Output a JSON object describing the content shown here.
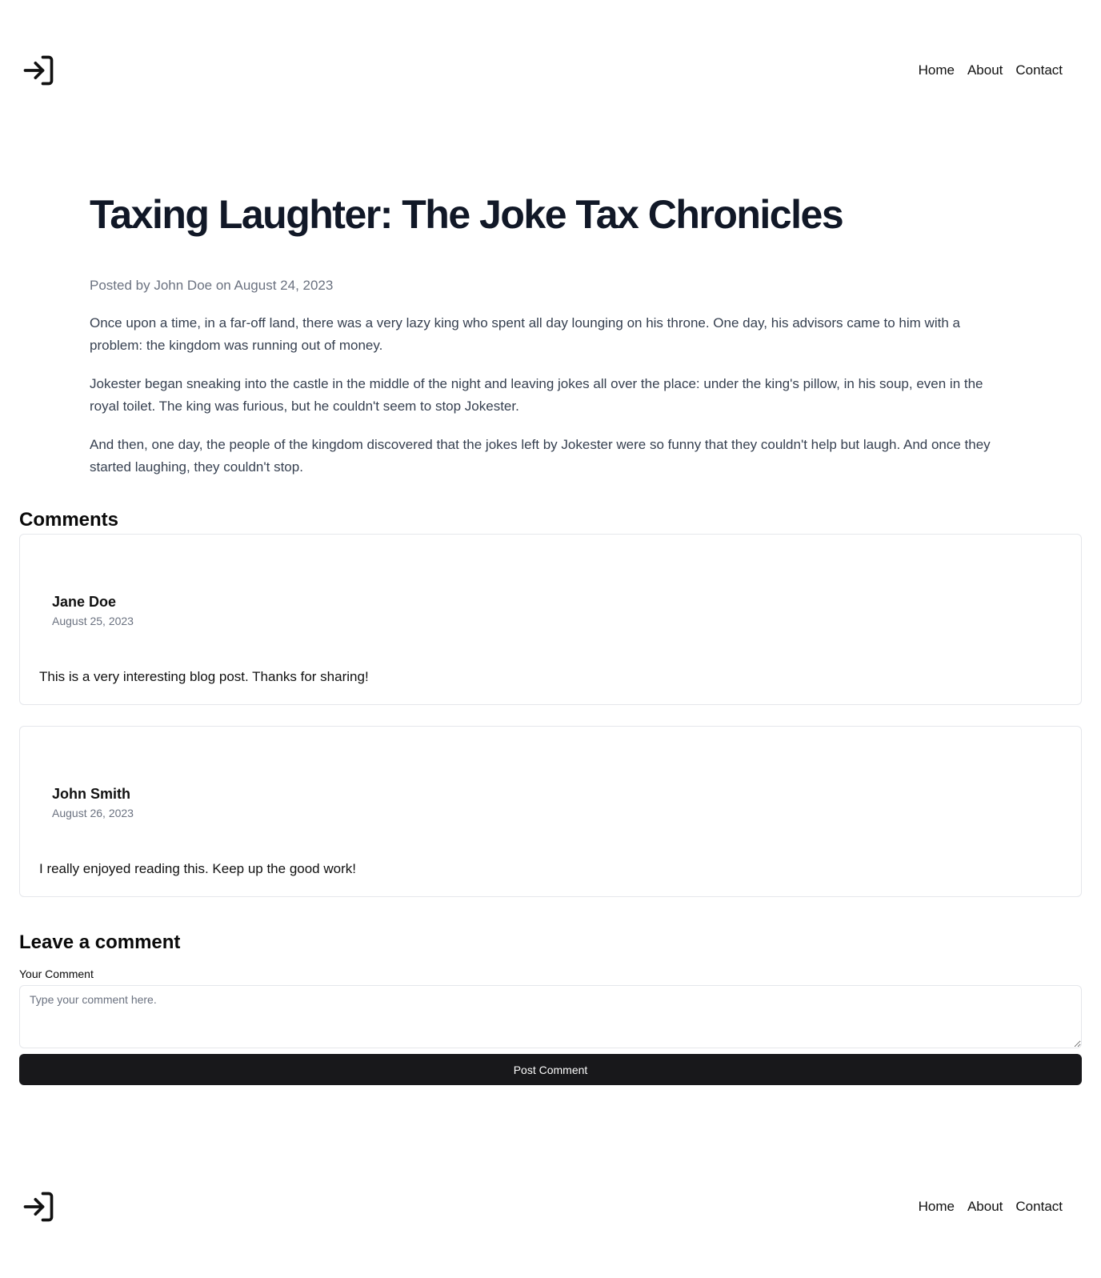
{
  "header": {
    "logo_icon": "log-in-icon",
    "nav": [
      "Home",
      "About",
      "Contact"
    ]
  },
  "article": {
    "title": "Taxing Laughter: The Joke Tax Chronicles",
    "meta": "Posted by John Doe on August 24, 2023",
    "paragraphs": [
      "Once upon a time, in a far-off land, there was a very lazy king who spent all day lounging on his throne. One day, his advisors came to him with a problem: the kingdom was running out of money.",
      "Jokester began sneaking into the castle in the middle of the night and leaving jokes all over the place: under the king's pillow, in his soup, even in the royal toilet. The king was furious, but he couldn't seem to stop Jokester.",
      "And then, one day, the people of the kingdom discovered that the jokes left by Jokester were so funny that they couldn't help but laugh. And once they started laughing, they couldn't stop."
    ]
  },
  "comments": {
    "title": "Comments",
    "items": [
      {
        "author": "Jane Doe",
        "date": "August 25, 2023",
        "text": "This is a very interesting blog post. Thanks for sharing!"
      },
      {
        "author": "John Smith",
        "date": "August 26, 2023",
        "text": "I really enjoyed reading this. Keep up the good work!"
      }
    ]
  },
  "leave_comment": {
    "title": "Leave a comment",
    "label": "Your Comment",
    "placeholder": "Type your comment here.",
    "value": "",
    "button": "Post Comment"
  },
  "footer": {
    "logo_icon": "log-in-icon",
    "nav": [
      "Home",
      "About",
      "Contact"
    ]
  },
  "colors": {
    "title": "#111827",
    "muted": "#6b7280",
    "body": "#374151",
    "border": "#e5e7eb",
    "button_bg": "#18181b",
    "button_text": "#fafafa"
  }
}
